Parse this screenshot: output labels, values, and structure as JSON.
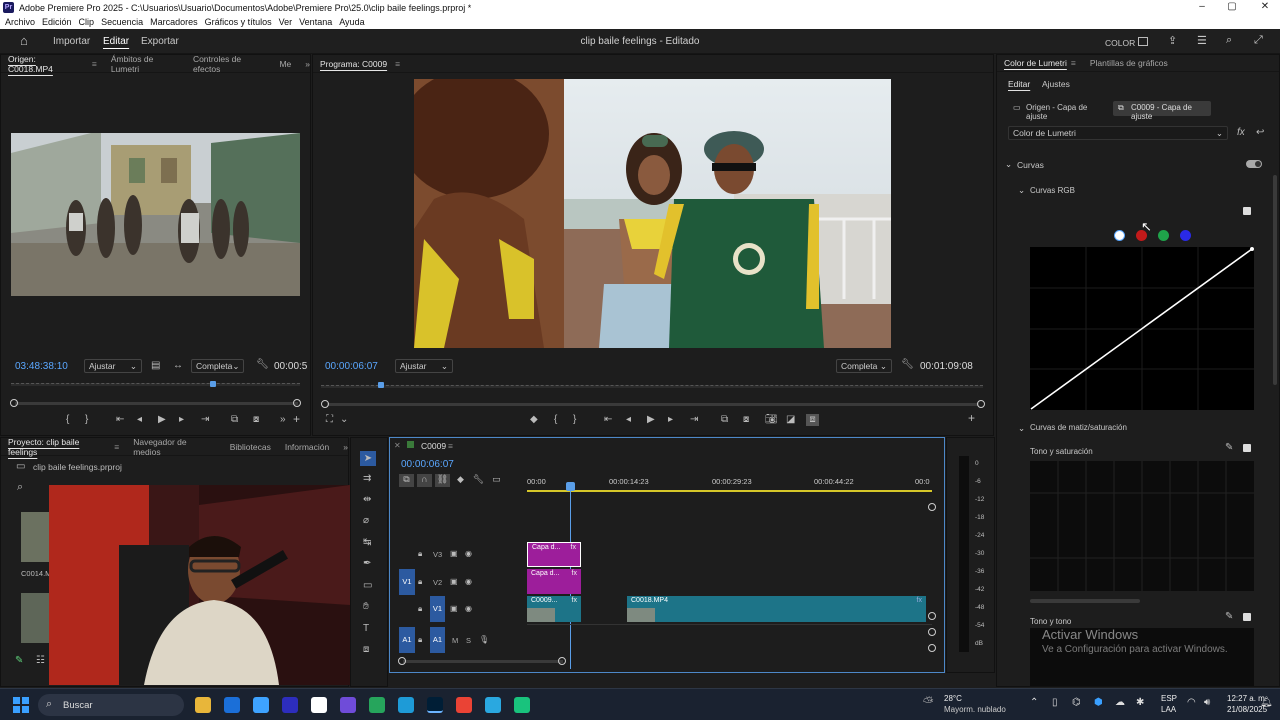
{
  "window": {
    "title": "Adobe Premiere Pro 2025 - C:\\Usuarios\\Usuario\\Documentos\\Adobe\\Premiere Pro\\25.0\\clip baile feelings.prproj *",
    "minimize": "–",
    "maximize": "▢",
    "close": "✕"
  },
  "menu": [
    "Archivo",
    "Edición",
    "Clip",
    "Secuencia",
    "Marcadores",
    "Gráficos y títulos",
    "Ver",
    "Ventana",
    "Ayuda"
  ],
  "appbar": {
    "home": "⌂",
    "import": "Importar",
    "edit": "Editar",
    "export": "Exportar",
    "project_title": "clip baile feelings",
    "project_status": "- Editado",
    "workspace": "COLOR"
  },
  "source": {
    "tabs": [
      "Origen: C0018.MP4",
      "Ámbitos de Lumetri",
      "Controles de efectos",
      "Me"
    ],
    "timecode": "03:48:38:10",
    "fit": "Ajustar",
    "quality": "Completa",
    "duration": "00:00:5",
    "playhead_fraction": 0.7
  },
  "program": {
    "tab": "Programa: C0009",
    "timecode": "00:00:06:07",
    "fit": "Ajustar",
    "quality": "Completa",
    "duration": "00:01:09:08",
    "playhead_fraction": 0.09
  },
  "project": {
    "tabs": [
      "Proyecto: clip baile feelings",
      "Navegador de medios",
      "Bibliotecas",
      "Información"
    ],
    "file": "clip baile feelings.prproj",
    "item1": "C0014.M"
  },
  "timeline": {
    "sequence": "C0009",
    "timecode": "00:00:06:07",
    "ruler": [
      "00:00",
      "00:00:14:23",
      "00:00:29:23",
      "00:00:44:22",
      "00:0"
    ],
    "tracks": [
      "V3",
      "V2",
      "V1",
      "A1"
    ],
    "clips": [
      {
        "label": "Capa d...",
        "track": "V3"
      },
      {
        "label": "Capa d...",
        "track": "V2"
      },
      {
        "label": "C0009...",
        "track": "V1"
      },
      {
        "label": "C0018.MP4",
        "track": "V1"
      }
    ],
    "fx": "fx",
    "audio_meter": [
      "0",
      "-6",
      "-12",
      "-18",
      "-24",
      "-30",
      "-36",
      "-42",
      "-48",
      "-54",
      "dB"
    ],
    "solo": "S",
    "mute": "M"
  },
  "lumetri": {
    "tabs": [
      "Color de Lumetri",
      "Plantillas de gráficos"
    ],
    "subtabs": [
      "Editar",
      "Ajustes"
    ],
    "source_clip": "Origen - Capa de ajuste",
    "target_clip": "C0009 - Capa de ajuste",
    "effect": "Color de Lumetri",
    "section": "Curvas",
    "rgb_curves": "Curvas RGB",
    "hue_sat_curves": "Curvas de matiz/saturación",
    "hue_vs_sat": "Tono y saturación",
    "hue_vs_hue": "Tono y tono",
    "channel_colors": [
      "#ffffff",
      "#c21a1a",
      "#1fa34a",
      "#2a2ae6"
    ]
  },
  "watermark": {
    "line1": "Activar Windows",
    "line2": "Ve a Configuración para activar Windows."
  },
  "taskbar": {
    "search": "Buscar",
    "weather_temp": "28°C",
    "weather_desc": "Mayorm. nublado",
    "lang1": "ESP",
    "lang2": "LAA",
    "time": "12:27 a. m.",
    "date": "21/08/2025",
    "apps": [
      "#e8b63a",
      "#1b6fd8",
      "#3ea3ff",
      "#2d2dbd",
      "#ffffff",
      "#6f4cd9",
      "#26a55c",
      "#1e9bd7",
      "#001e36",
      "#ea4335",
      "#2aa8e0",
      "#19c37d"
    ]
  }
}
